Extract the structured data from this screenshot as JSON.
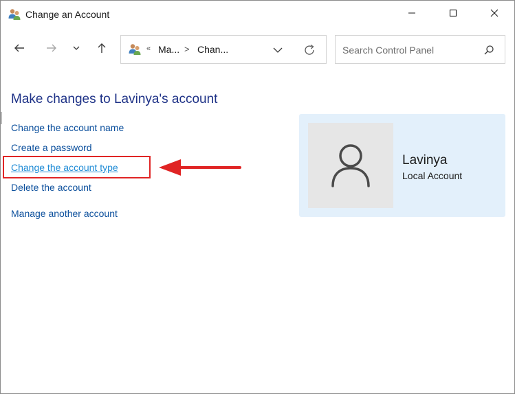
{
  "window": {
    "title": "Change an Account",
    "caption_buttons": [
      "minimize-icon",
      "maximize-icon",
      "close-icon"
    ]
  },
  "nav": {
    "icons": [
      "back-arrow-icon",
      "forward-arrow-icon",
      "recent-locations-chevron-icon",
      "up-arrow-icon"
    ]
  },
  "address": {
    "overflow": "«",
    "crumbs": [
      "Ma...",
      "Chan..."
    ],
    "separator": ">"
  },
  "search": {
    "placeholder": "Search Control Panel",
    "value": ""
  },
  "main": {
    "heading": "Make changes to Lavinya's account",
    "links": [
      "Change the account name",
      "Create a password",
      "Change the account type",
      "Delete the account",
      "Manage another account"
    ]
  },
  "account": {
    "name": "Lavinya",
    "type": "Local Account"
  },
  "colors": {
    "heading": "#1e3287",
    "link": "#0b4f9c",
    "link_hover": "#1e8bd6",
    "annotation": "#e02424",
    "card_bg": "#e3f0fb"
  }
}
